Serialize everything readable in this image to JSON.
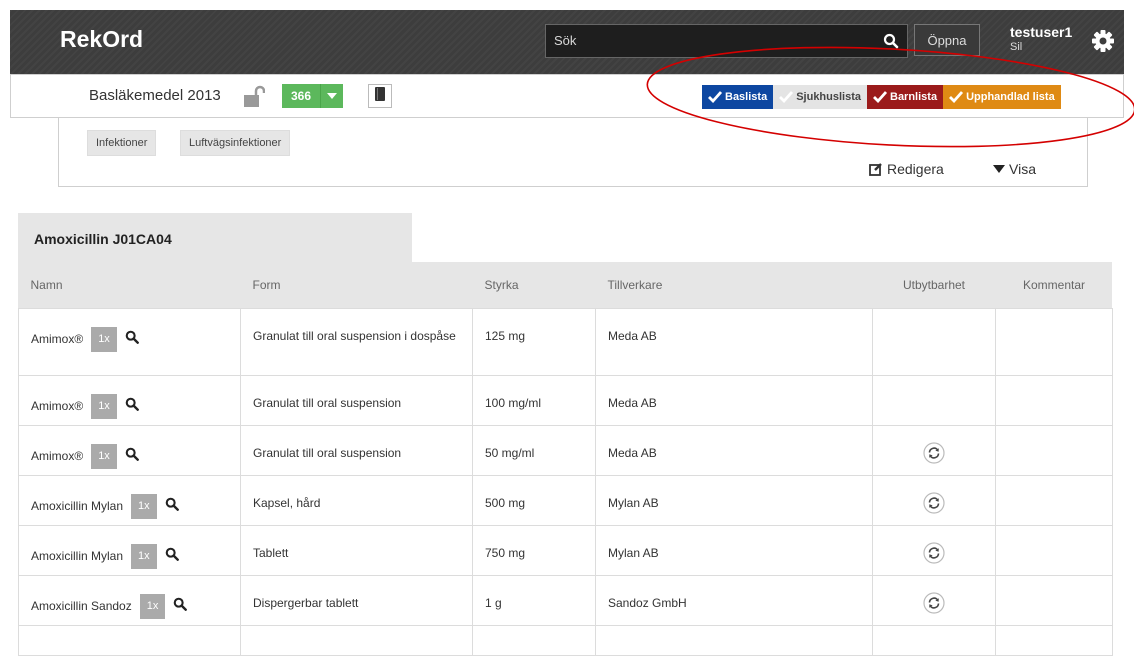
{
  "app": {
    "title": "RekOrd"
  },
  "search": {
    "placeholder": "Sök",
    "open_label": "Öppna"
  },
  "user": {
    "name": "testuser1",
    "sub": "Sil"
  },
  "list": {
    "title": "Basläkemedel 2013",
    "count": "366"
  },
  "filters": [
    {
      "label": "Baslista",
      "color": "#0d47a1"
    },
    {
      "label": "Sjukhuslista",
      "color": "#e4e4e4"
    },
    {
      "label": "Barnlista",
      "color": "#9b1b1b"
    },
    {
      "label": "Upphandlad lista",
      "color": "#df8a14"
    }
  ],
  "tags": [
    "Infektioner",
    "Luftvägsinfektioner"
  ],
  "actions": {
    "edit": "Redigera",
    "show": "Visa"
  },
  "drug": {
    "title": "Amoxicillin J01CA04"
  },
  "table": {
    "headers": [
      "Namn",
      "Form",
      "Styrka",
      "Tillverkare",
      "Utbytbarhet",
      "Kommentar"
    ],
    "rows": [
      {
        "name": "Amimox®",
        "qty": "1x",
        "form": "Granulat till oral suspension i dospåse",
        "strength": "125 mg",
        "maker": "Meda AB",
        "swap": false
      },
      {
        "name": "Amimox®",
        "qty": "1x",
        "form": "Granulat till oral suspension",
        "strength": "100 mg/ml",
        "maker": "Meda AB",
        "swap": false
      },
      {
        "name": "Amimox®",
        "qty": "1x",
        "form": "Granulat till oral suspension",
        "strength": "50 mg/ml",
        "maker": "Meda AB",
        "swap": true
      },
      {
        "name": "Amoxicillin Mylan",
        "qty": "1x",
        "form": "Kapsel, hård",
        "strength": "500 mg",
        "maker": "Mylan AB",
        "swap": true
      },
      {
        "name": "Amoxicillin Mylan",
        "qty": "1x",
        "form": "Tablett",
        "strength": "750 mg",
        "maker": "Mylan AB",
        "swap": true
      },
      {
        "name": "Amoxicillin Sandoz",
        "qty": "1x",
        "form": "Dispergerbar tablett",
        "strength": "1 g",
        "maker": "Sandoz GmbH",
        "swap": true
      },
      {
        "name": "",
        "qty": "",
        "form": "",
        "strength": "",
        "maker": "",
        "swap": false
      }
    ]
  },
  "colors": {
    "topbar": "#3d3d3d",
    "annotation": "#d40000",
    "count_badge": "#5cb85c"
  }
}
